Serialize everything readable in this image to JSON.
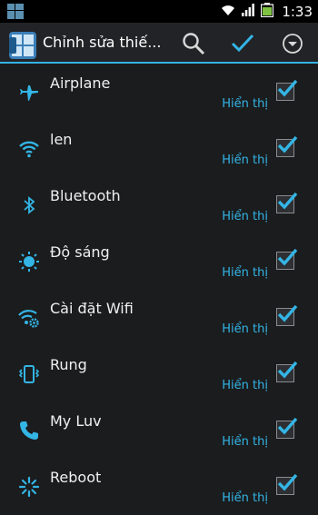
{
  "status_bar": {
    "time": "1:33"
  },
  "action_bar": {
    "title": "Chỉnh sửa thiế..."
  },
  "colors": {
    "accent": "#33b5e5",
    "background": "#1b1c1e"
  },
  "items": [
    {
      "label": "Airplane",
      "status": "Hiển thị",
      "icon": "airplane-icon",
      "checked": true
    },
    {
      "label": "len",
      "status": "Hiển thị",
      "icon": "wifi-icon",
      "checked": true
    },
    {
      "label": "Bluetooth",
      "status": "Hiển thị",
      "icon": "bluetooth-icon",
      "checked": true
    },
    {
      "label": "Độ sáng",
      "status": "Hiển thị",
      "icon": "brightness-icon",
      "checked": true
    },
    {
      "label": "Cài đặt Wifi",
      "status": "Hiển thị",
      "icon": "wifi-settings-icon",
      "checked": true
    },
    {
      "label": "Rung",
      "status": "Hiển thị",
      "icon": "vibrate-icon",
      "checked": true
    },
    {
      "label": "My Luv",
      "status": "Hiển thị",
      "icon": "phone-icon",
      "checked": true
    },
    {
      "label": "Reboot",
      "status": "Hiển thị",
      "icon": "reboot-icon",
      "checked": true
    }
  ]
}
